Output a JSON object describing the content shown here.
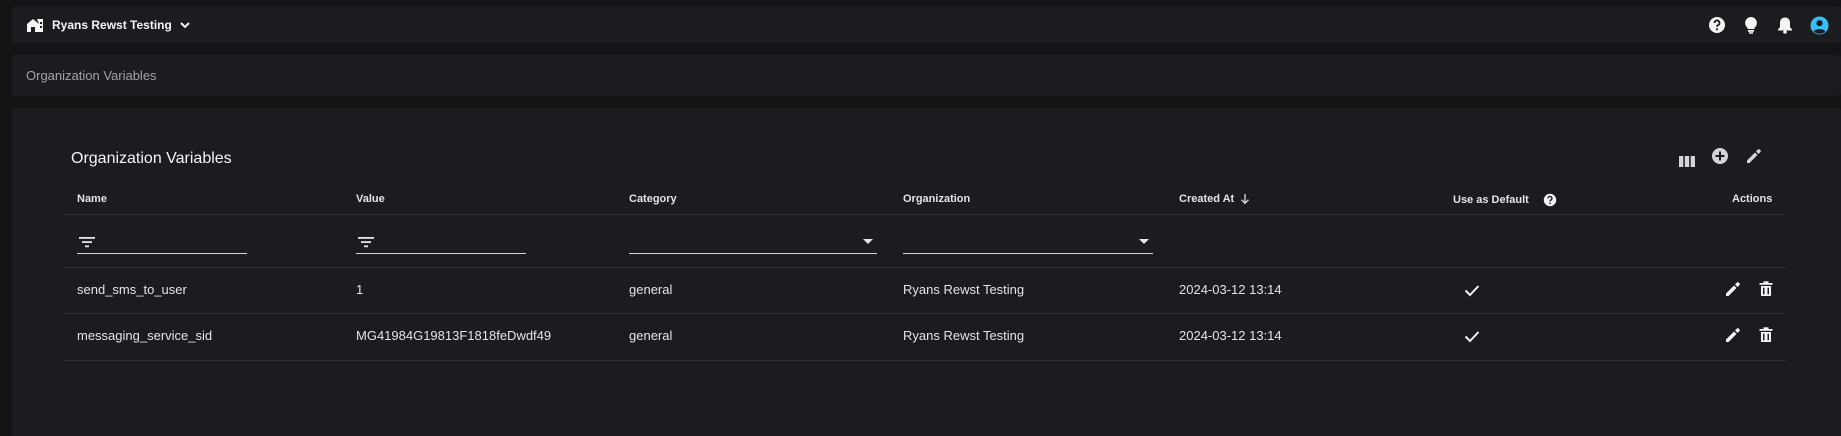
{
  "header": {
    "org_name": "Ryans Rewst Testing",
    "icons": [
      "home-building-icon",
      "chevron-down-icon",
      "help-icon",
      "lightbulb-icon",
      "bell-icon",
      "account-icon"
    ]
  },
  "breadcrumb": {
    "current": "Organization Variables"
  },
  "card": {
    "title": "Organization Variables",
    "toolbar_icons": [
      "columns-icon",
      "add-circle-icon",
      "edit-icon"
    ]
  },
  "table": {
    "columns": {
      "name": "Name",
      "value": "Value",
      "category": "Category",
      "organization": "Organization",
      "created_at": "Created At",
      "use_as_default": "Use as Default",
      "actions": "Actions"
    },
    "sort": {
      "column": "Created At",
      "direction": "descending"
    },
    "rows": [
      {
        "name": "send_sms_to_user",
        "value": "1",
        "category": "general",
        "organization": "Ryans Rewst Testing",
        "created_at": "2024-03-12 13:14",
        "use_as_default": true
      },
      {
        "name": "messaging_service_sid",
        "value": "MG41984G19813F1818feDwdf49",
        "category": "general",
        "organization": "Ryans Rewst Testing",
        "created_at": "2024-03-12 13:14",
        "use_as_default": true
      }
    ]
  },
  "colors": {
    "background": "#141416",
    "surface": "#1b1b20",
    "divider": "#303036",
    "text": "#e4e4e7",
    "accent": "#38bdf8"
  }
}
